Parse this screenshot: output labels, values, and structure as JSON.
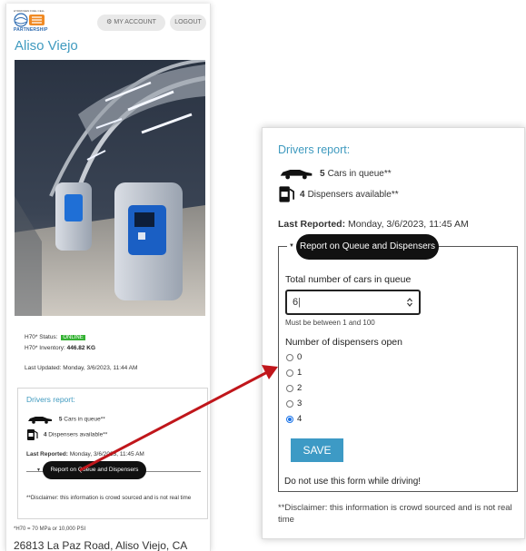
{
  "header": {
    "logo_tagline": "HYDROGEN FUEL CELL",
    "logo_word": "PARTNERSHIP",
    "my_account_label": "MY ACCOUNT",
    "logout_label": "LOGOUT"
  },
  "station": {
    "name": "Aliso Viejo",
    "status_label": "H70* Status:",
    "status_value": "ONLINE",
    "status_color": "#34b233",
    "inventory_label": "H70* Inventory:",
    "inventory_value": "446.82 KG",
    "last_updated": "Last Updated: Monday, 3/6/2023, 11:44 AM",
    "footnote": "*H70 = 70 MPa or 10,000 PSI",
    "address": "26813 La Paz Road, Aliso Viejo, CA"
  },
  "drivers_report": {
    "title": "Drivers report:",
    "cars_count": "5",
    "cars_label": "Cars in queue**",
    "dispensers_count": "4",
    "dispensers_label": "Dispensers available**",
    "last_reported_label": "Last Reported:",
    "last_reported_value": "Monday, 3/6/2023, 11:45 AM",
    "report_button_label": "Report on Queue and Dispensers",
    "disclaimer": "**Disclaimer: this information is crowd sourced and is not real time",
    "icons": [
      "car-icon",
      "fuel-pump-icon"
    ]
  },
  "form": {
    "cars_label": "Total number of cars in queue",
    "cars_value": "6",
    "cars_help": "Must be between 1 and 100",
    "dispensers_label": "Number of dispensers open",
    "options": [
      "0",
      "1",
      "2",
      "3",
      "4"
    ],
    "selected": "4",
    "save_label": "SAVE",
    "warning": "Do not use this form while driving!"
  },
  "colors": {
    "accent": "#3f9abf",
    "button_dark": "#111111",
    "save_button": "#3d9ac5",
    "arrow": "#c0161b"
  }
}
